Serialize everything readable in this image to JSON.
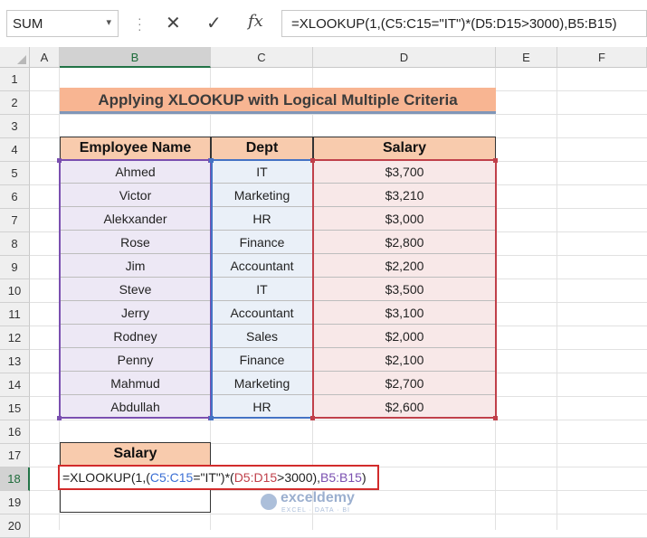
{
  "formula_bar": {
    "name_box": "SUM",
    "name_box_arrow": "▾",
    "cancel_icon": "✕",
    "enter_icon": "✓",
    "fx_label": "fx",
    "formula": "=XLOOKUP(1,(C5:C15=\"IT\")*(D5:D15>3000),B5:B15)"
  },
  "columns": [
    "A",
    "B",
    "C",
    "D",
    "E",
    "F"
  ],
  "selected_column": "B",
  "rows": [
    "1",
    "2",
    "3",
    "4",
    "5",
    "6",
    "7",
    "8",
    "9",
    "10",
    "11",
    "12",
    "13",
    "14",
    "15",
    "16",
    "17",
    "18",
    "19",
    "20"
  ],
  "selected_row": "18",
  "title": "Applying XLOOKUP with Logical Multiple Criteria",
  "table": {
    "headers": [
      "Employee Name",
      "Dept",
      "Salary"
    ],
    "rows": [
      [
        "Ahmed",
        "IT",
        "$3,700"
      ],
      [
        "Victor",
        "Marketing",
        "$3,210"
      ],
      [
        "Alekxander",
        "HR",
        "$3,000"
      ],
      [
        "Rose",
        "Finance",
        "$2,800"
      ],
      [
        "Jim",
        "Accountant",
        "$2,200"
      ],
      [
        "Steve",
        "IT",
        "$3,500"
      ],
      [
        "Jerry",
        "Accountant",
        "$3,100"
      ],
      [
        "Rodney",
        "Sales",
        "$2,000"
      ],
      [
        "Penny",
        "Finance",
        "$2,100"
      ],
      [
        "Mahmud",
        "Marketing",
        "$2,700"
      ],
      [
        "Abdullah",
        "HR",
        "$2,600"
      ]
    ]
  },
  "lookup": {
    "header": "Salary",
    "edit_parts": {
      "p1": "=XLOOKUP(1,(",
      "p2": "C5:C15",
      "p3": "=\"IT\")*(",
      "p4": "D5:D15",
      "p5": ">3000),",
      "p6": "B5:B15",
      "p7": ")"
    }
  },
  "watermark": {
    "name": "exceldemy",
    "tagline": "EXCEL · DATA · BI"
  },
  "colors": {
    "range_b": "#7a4fb0",
    "range_c": "#4472c4",
    "range_d": "#c0404a",
    "header_fill": "#f8cbad",
    "title_fill": "#f8b592"
  }
}
